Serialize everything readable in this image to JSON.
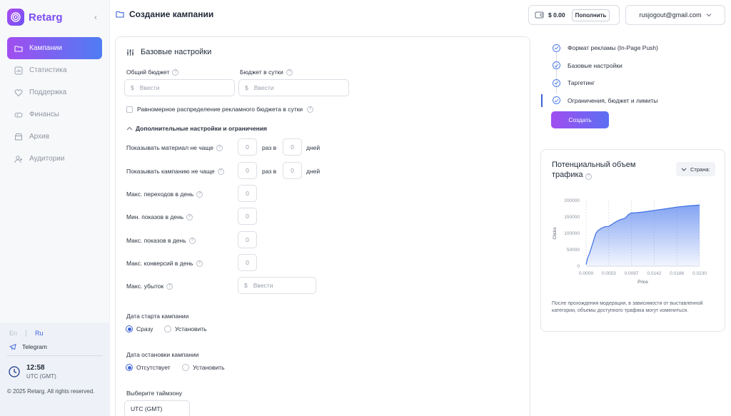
{
  "brand": {
    "name": "Retarg"
  },
  "sidebar": {
    "items": [
      {
        "label": "Кампании",
        "icon": "folder-icon",
        "active": true
      },
      {
        "label": "Статистика",
        "icon": "chart-icon"
      },
      {
        "label": "Поддержка",
        "icon": "heart-icon"
      },
      {
        "label": "Финансы",
        "icon": "gamepad-icon"
      },
      {
        "label": "Архив",
        "icon": "archive-icon"
      },
      {
        "label": "Аудитории",
        "icon": "user-add-icon"
      }
    ],
    "lang_en": "En",
    "lang_ru": "Ru",
    "telegram": "Telegram",
    "time": "12:58",
    "timezone": "UTC (GMT)",
    "copyright": "© 2025 Retarg. All rights reserved."
  },
  "header": {
    "title": "Создание кампании",
    "balance": "$ 0.00",
    "topup_label": "Пополнить",
    "user_email": "rusjogout@gmail.com"
  },
  "form": {
    "section_title": "Базовые настройки",
    "total_budget_label": "Общий бюджет",
    "total_budget_placeholder": "Ввести",
    "daily_budget_label": "Бюджет в сутки",
    "daily_budget_placeholder": "Ввести",
    "uniform_label": "Равномерное распределение рекламного бюджета в сутки",
    "advanced_label": "Дополнительные настройки и ограничения",
    "freq_material_label": "Показывать материал не чаще",
    "freq_campaign_label": "Показывать кампанию не чаще",
    "times_in": "раз в",
    "days": "дней",
    "freq_material_times": "0",
    "freq_material_days": "0",
    "freq_campaign_times": "0",
    "freq_campaign_days": "0",
    "max_clicks_label": "Макс. переходов в день",
    "max_clicks": "0",
    "min_impr_label": "Мин. показов в день",
    "min_impr": "0",
    "max_impr_label": "Макс. показов в день",
    "max_impr": "0",
    "max_conv_label": "Макс. конверсий в день",
    "max_conv": "0",
    "max_loss_label": "Макс. убыток",
    "max_loss_placeholder": "Ввести",
    "currency": "$",
    "start_label": "Дата старта кампании",
    "start_now": "Сразу",
    "start_set": "Установить",
    "stop_label": "Дата остановки кампании",
    "stop_none": "Отсутствует",
    "stop_set": "Установить",
    "tz_label": "Выберите таймзону",
    "tz_value": "UTC (GMT)"
  },
  "steps": {
    "items": [
      "Формат рекламы (In-Page Push)",
      "Базовые настройки",
      "Таргетинг",
      "Ограничения, бюджет и лимиты"
    ],
    "create_label": "Создать"
  },
  "traffic": {
    "title": "Потенциальный объем трафика",
    "country_label": "Страна:",
    "note": "После прохождения модерации, в зависимости от выставленной категории, объемы доступного трафика могут измениться."
  },
  "chart_data": {
    "type": "area",
    "xlabel": "Price",
    "ylabel": "Clicks",
    "x_ticks": [
      "0.0009",
      "0.0053",
      "0.0097",
      "0.0142",
      "0.0186",
      "0.0230"
    ],
    "y_ticks": [
      "0",
      "50000",
      "100000",
      "150000",
      "200000"
    ],
    "xlim": [
      0.0009,
      0.023
    ],
    "ylim": [
      0,
      200000
    ],
    "x": [
      0.0009,
      0.0012,
      0.0016,
      0.002,
      0.0024,
      0.0028,
      0.0032,
      0.0038,
      0.0045,
      0.0053,
      0.006,
      0.0068,
      0.0076,
      0.0085,
      0.0092,
      0.0097,
      0.0108,
      0.012,
      0.0142,
      0.0165,
      0.0186,
      0.021,
      0.023
    ],
    "y": [
      5000,
      25000,
      40000,
      60000,
      80000,
      100000,
      108000,
      115000,
      120000,
      121000,
      128000,
      136000,
      142000,
      146000,
      158000,
      162000,
      163000,
      165000,
      170000,
      175000,
      180000,
      184000,
      186000
    ],
    "grid": "dashed vertical"
  }
}
